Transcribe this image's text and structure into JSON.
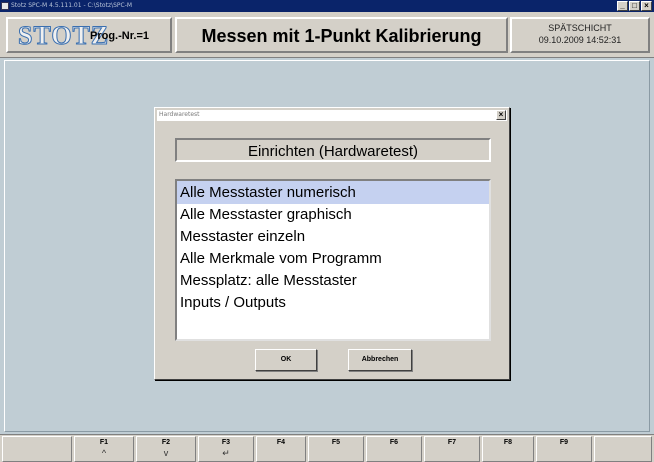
{
  "window": {
    "title": "Stotz SPC-M 4.5.111.01 - C:\\Stotz\\SPC-M"
  },
  "header": {
    "logo": "STOTZ",
    "prog": "Prog.-Nr.=1",
    "title": "Messen mit 1-Punkt Kalibrierung",
    "shift": "SPÄTSCHICHT",
    "datetime": "09.10.2009 14:52:31"
  },
  "dialog": {
    "title": "Hardwaretest",
    "heading": "Einrichten (Hardwaretest)",
    "items": [
      "Alle Messtaster numerisch",
      "Alle Messtaster graphisch",
      "Messtaster einzeln",
      "Alle Merkmale vom Programm",
      "Messplatz: alle Messtaster",
      "Inputs / Outputs"
    ],
    "selected_index": 0,
    "ok_label": "OK",
    "cancel_label": "Abbrechen"
  },
  "fkeys": [
    {
      "label": "",
      "symbol": ""
    },
    {
      "label": "F1",
      "symbol": "^"
    },
    {
      "label": "F2",
      "symbol": "v"
    },
    {
      "label": "F3",
      "symbol": "↵"
    },
    {
      "label": "F4",
      "symbol": ""
    },
    {
      "label": "F5",
      "symbol": ""
    },
    {
      "label": "F6",
      "symbol": ""
    },
    {
      "label": "F7",
      "symbol": ""
    },
    {
      "label": "F8",
      "symbol": ""
    },
    {
      "label": "F9",
      "symbol": ""
    },
    {
      "label": "",
      "symbol": ""
    }
  ]
}
